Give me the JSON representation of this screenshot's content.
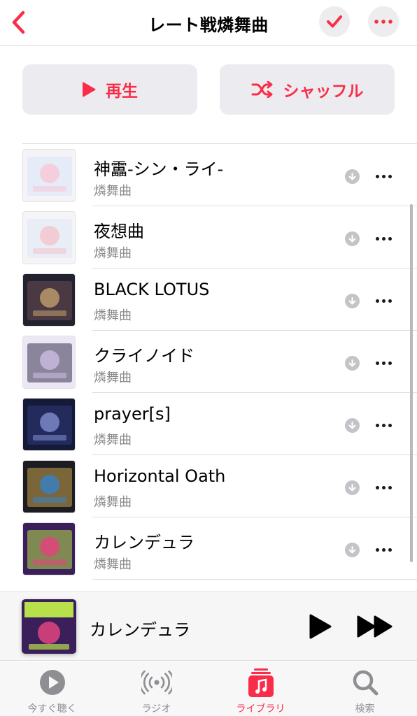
{
  "header": {
    "title": "レート戦燐舞曲"
  },
  "actions": {
    "play_label": "再生",
    "shuffle_label": "シャッフル"
  },
  "colors": {
    "accent": "#fa2d48",
    "secondary_text": "#8a8a8e",
    "button_bg": "#ececf0"
  },
  "tracks": [
    {
      "title": "神靁-シン・ライ-",
      "artist": "燐舞曲",
      "art": [
        "#f4f4f6",
        "#d8e4f8",
        "#f7c9d8"
      ]
    },
    {
      "title": "夜想曲",
      "artist": "燐舞曲",
      "art": [
        "#f5f5f7",
        "#dfe6f5",
        "#f3c6cf"
      ]
    },
    {
      "title": "BLACK LOTUS",
      "artist": "燐舞曲",
      "art": [
        "#22232e",
        "#6c4a55",
        "#b89a6a"
      ]
    },
    {
      "title": "クライノイド",
      "artist": "燐舞曲",
      "art": [
        "#ece7f4",
        "#3a3550",
        "#c8b9de"
      ]
    },
    {
      "title": "prayer[s]",
      "artist": "燐舞曲",
      "art": [
        "#141a38",
        "#2d3a7a",
        "#7b88c8"
      ]
    },
    {
      "title": "Horizontal Oath",
      "artist": "燐舞曲",
      "art": [
        "#1c1c22",
        "#c9a44a",
        "#3b7fc2"
      ]
    },
    {
      "title": "カレンデュラ",
      "artist": "燐舞曲",
      "art": [
        "#3b1f5a",
        "#b8e04a",
        "#e2447e"
      ]
    }
  ],
  "now_playing": {
    "title": "カレンデュラ",
    "art": [
      "#3b1f5a",
      "#b8e04a",
      "#e2447e"
    ]
  },
  "tabs": [
    {
      "label": "今すぐ聴く",
      "icon": "play-circle-icon",
      "active": false
    },
    {
      "label": "ラジオ",
      "icon": "radio-waves-icon",
      "active": false
    },
    {
      "label": "ライブラリ",
      "icon": "library-music-icon",
      "active": true
    },
    {
      "label": "検索",
      "icon": "search-icon",
      "active": false
    }
  ]
}
